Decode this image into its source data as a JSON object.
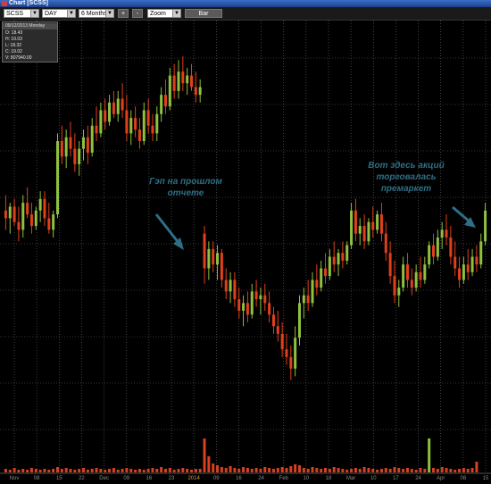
{
  "window": {
    "title": "Chart [SCSS]"
  },
  "toolbar": {
    "symbol": "SCSS",
    "interval": "DAY",
    "range": "6 Months",
    "plus_label": "+",
    "minus_label": "-",
    "zoom": "Zoom",
    "type_label": "Bar"
  },
  "info_panel": {
    "header": "09/12/2013 Monday",
    "open": "O: 18.43",
    "high": "H: 19.03",
    "low": "L: 18.32",
    "close": "C: 19.02",
    "volume": "V: 807940.00"
  },
  "annotations": {
    "gap": [
      "Гэп на прошлом",
      "отчете"
    ],
    "premarket": [
      "Вот здесь акций",
      "торговалась",
      "премаркет"
    ]
  },
  "chart_data": {
    "type": "candlestick",
    "colors": {
      "up": "#8ec13f",
      "down": "#e0401a",
      "volume": "#d84020",
      "grid": "#6a6a6a"
    },
    "candles": [
      [
        16.8,
        17.2,
        16.3,
        16.6
      ],
      [
        16.6,
        17.0,
        16.2,
        16.9
      ],
      [
        16.9,
        17.1,
        16.4,
        16.5
      ],
      [
        16.5,
        16.9,
        16.0,
        16.3
      ],
      [
        16.3,
        17.2,
        16.1,
        17.0
      ],
      [
        17.0,
        17.4,
        16.6,
        16.7
      ],
      [
        16.7,
        17.0,
        16.2,
        16.4
      ],
      [
        16.4,
        16.9,
        16.3,
        16.8
      ],
      [
        16.8,
        17.3,
        16.5,
        17.1
      ],
      [
        17.1,
        17.3,
        16.4,
        16.6
      ],
      [
        16.6,
        17.0,
        16.2,
        16.3
      ],
      [
        16.3,
        16.8,
        16.1,
        16.7
      ],
      [
        16.7,
        18.8,
        16.6,
        18.6
      ],
      [
        18.6,
        19.0,
        18.0,
        18.2
      ],
      [
        18.2,
        18.9,
        17.9,
        18.7
      ],
      [
        18.7,
        19.1,
        18.2,
        18.4
      ],
      [
        18.4,
        18.8,
        17.8,
        18.0
      ],
      [
        18.0,
        18.6,
        17.7,
        18.4
      ],
      [
        18.4,
        18.9,
        18.1,
        18.7
      ],
      [
        18.7,
        19.0,
        18.0,
        18.3
      ],
      [
        18.3,
        19.2,
        18.2,
        19.0
      ],
      [
        19.0,
        19.5,
        18.6,
        18.8
      ],
      [
        18.8,
        19.6,
        18.7,
        19.4
      ],
      [
        19.4,
        19.7,
        18.9,
        19.1
      ],
      [
        19.1,
        19.8,
        19.0,
        19.6
      ],
      [
        19.6,
        19.9,
        19.2,
        19.3
      ],
      [
        19.3,
        19.9,
        19.1,
        19.7
      ],
      [
        19.7,
        20.1,
        19.2,
        19.4
      ],
      [
        19.4,
        19.8,
        18.6,
        18.8
      ],
      [
        18.8,
        19.4,
        18.5,
        19.2
      ],
      [
        19.2,
        19.5,
        18.7,
        18.9
      ],
      [
        18.9,
        19.2,
        18.4,
        18.6
      ],
      [
        18.6,
        19.6,
        18.5,
        19.4
      ],
      [
        19.4,
        19.7,
        18.8,
        19.0
      ],
      [
        19.0,
        19.3,
        18.6,
        18.8
      ],
      [
        18.8,
        19.5,
        18.6,
        19.3
      ],
      [
        19.3,
        20.0,
        19.1,
        19.8
      ],
      [
        19.8,
        20.2,
        19.3,
        19.5
      ],
      [
        19.5,
        20.5,
        19.4,
        20.3
      ],
      [
        20.3,
        20.6,
        19.7,
        19.9
      ],
      [
        19.9,
        20.7,
        19.7,
        20.4
      ],
      [
        20.4,
        20.8,
        19.9,
        20.1
      ],
      [
        20.1,
        20.5,
        19.8,
        20.3
      ],
      [
        20.3,
        20.6,
        19.9,
        20.0
      ],
      [
        20.0,
        20.4,
        19.6,
        19.8
      ],
      [
        19.8,
        20.2,
        19.6,
        20.0
      ],
      [
        16.2,
        16.4,
        14.9,
        15.3
      ],
      [
        15.3,
        16.0,
        15.0,
        15.8
      ],
      [
        15.8,
        16.0,
        15.2,
        15.4
      ],
      [
        15.4,
        15.9,
        15.0,
        15.7
      ],
      [
        15.7,
        15.8,
        14.8,
        15.0
      ],
      [
        15.0,
        15.3,
        14.5,
        14.7
      ],
      [
        14.7,
        15.2,
        14.4,
        15.0
      ],
      [
        15.0,
        15.2,
        14.3,
        14.5
      ],
      [
        14.5,
        14.8,
        14.0,
        14.2
      ],
      [
        14.2,
        14.6,
        13.8,
        14.4
      ],
      [
        14.4,
        14.7,
        13.9,
        14.1
      ],
      [
        14.1,
        14.9,
        14.0,
        14.7
      ],
      [
        14.7,
        15.0,
        14.3,
        14.5
      ],
      [
        14.5,
        14.8,
        14.1,
        14.6
      ],
      [
        14.6,
        14.9,
        14.2,
        14.4
      ],
      [
        14.4,
        14.7,
        13.9,
        14.1
      ],
      [
        14.1,
        14.3,
        13.6,
        13.8
      ],
      [
        13.8,
        14.2,
        13.4,
        13.6
      ],
      [
        13.6,
        13.9,
        13.0,
        13.2
      ],
      [
        13.2,
        13.6,
        12.8,
        13.0
      ],
      [
        13.0,
        13.3,
        12.4,
        12.7
      ],
      [
        12.7,
        13.8,
        12.5,
        13.5
      ],
      [
        13.5,
        14.6,
        13.3,
        14.4
      ],
      [
        14.4,
        14.8,
        14.0,
        14.6
      ],
      [
        14.6,
        15.0,
        14.2,
        14.4
      ],
      [
        14.4,
        15.2,
        14.3,
        15.0
      ],
      [
        15.0,
        15.4,
        14.6,
        14.8
      ],
      [
        14.8,
        15.5,
        14.7,
        15.3
      ],
      [
        15.3,
        15.7,
        14.9,
        15.1
      ],
      [
        15.1,
        15.8,
        15.0,
        15.6
      ],
      [
        15.6,
        16.0,
        15.2,
        15.4
      ],
      [
        15.4,
        15.8,
        15.1,
        15.7
      ],
      [
        15.7,
        16.0,
        15.3,
        15.5
      ],
      [
        15.5,
        16.0,
        15.4,
        15.9
      ],
      [
        15.9,
        17.0,
        15.8,
        16.8
      ],
      [
        16.8,
        17.1,
        16.0,
        16.2
      ],
      [
        16.2,
        16.6,
        15.9,
        16.4
      ],
      [
        16.4,
        16.7,
        15.8,
        16.0
      ],
      [
        16.0,
        16.6,
        15.9,
        16.5
      ],
      [
        16.5,
        16.9,
        16.1,
        16.3
      ],
      [
        16.3,
        16.8,
        16.2,
        16.7
      ],
      [
        16.7,
        17.0,
        16.0,
        16.2
      ],
      [
        16.2,
        16.5,
        15.5,
        15.7
      ],
      [
        15.7,
        16.0,
        14.9,
        15.1
      ],
      [
        15.1,
        15.5,
        14.4,
        14.6
      ],
      [
        14.6,
        15.0,
        14.3,
        14.8
      ],
      [
        14.8,
        15.6,
        14.7,
        15.4
      ],
      [
        15.4,
        15.7,
        14.8,
        15.0
      ],
      [
        15.0,
        15.3,
        14.6,
        14.8
      ],
      [
        14.8,
        15.4,
        14.7,
        15.2
      ],
      [
        15.2,
        15.6,
        14.8,
        15.0
      ],
      [
        15.0,
        15.6,
        14.9,
        15.4
      ],
      [
        15.4,
        16.0,
        15.3,
        15.9
      ],
      [
        15.9,
        16.2,
        15.4,
        15.6
      ],
      [
        15.6,
        16.3,
        15.5,
        16.1
      ],
      [
        16.1,
        16.5,
        15.8,
        16.3
      ],
      [
        16.3,
        16.7,
        15.9,
        16.1
      ],
      [
        16.1,
        16.4,
        15.4,
        15.6
      ],
      [
        15.6,
        16.0,
        15.1,
        15.3
      ],
      [
        15.3,
        15.6,
        14.8,
        15.0
      ],
      [
        15.0,
        15.6,
        14.9,
        15.4
      ],
      [
        15.4,
        15.8,
        15.0,
        15.2
      ],
      [
        15.2,
        15.8,
        15.1,
        15.6
      ],
      [
        15.6,
        15.9,
        15.2,
        15.4
      ],
      [
        15.4,
        16.2,
        15.3,
        16.0
      ],
      [
        16.0,
        17.0,
        15.9,
        16.8
      ]
    ],
    "volumes": [
      4,
      3,
      5,
      3,
      4,
      3,
      5,
      4,
      3,
      4,
      3,
      4,
      6,
      4,
      5,
      4,
      3,
      4,
      5,
      3,
      4,
      5,
      4,
      3,
      4,
      5,
      3,
      4,
      5,
      4,
      3,
      4,
      3,
      4,
      5,
      4,
      6,
      4,
      5,
      3,
      4,
      5,
      4,
      3,
      4,
      4,
      38,
      18,
      10,
      8,
      6,
      5,
      7,
      5,
      4,
      6,
      5,
      4,
      5,
      4,
      6,
      5,
      4,
      5,
      6,
      5,
      7,
      9,
      8,
      5,
      4,
      6,
      5,
      4,
      5,
      4,
      6,
      5,
      4,
      3,
      4,
      5,
      4,
      6,
      5,
      4,
      3,
      4,
      5,
      4,
      6,
      5,
      4,
      5,
      4,
      3,
      5,
      4,
      38,
      5,
      4,
      6,
      5,
      4,
      3,
      4,
      5,
      4,
      5,
      12
    ],
    "x_tick_labels": [
      "Nov",
      "08",
      "15",
      "22",
      "Dec",
      "09",
      "16",
      "23",
      "2014",
      "09",
      "16",
      "24",
      "Feb",
      "10",
      "18",
      "Mar",
      "10",
      "17",
      "24",
      "Apr",
      "08",
      "15"
    ]
  }
}
